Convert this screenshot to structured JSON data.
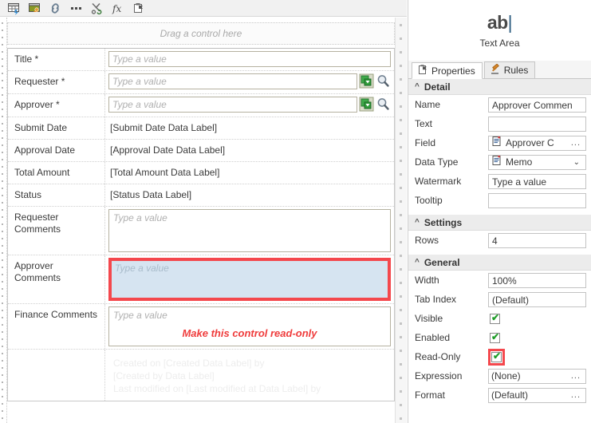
{
  "toolbar": {
    "buttons": [
      {
        "name": "insert-table-icon",
        "title": "Insert table"
      },
      {
        "name": "insert-image-icon",
        "title": "Insert image"
      },
      {
        "name": "insert-link-icon",
        "title": "Insert link"
      },
      {
        "name": "more-options-icon",
        "title": "More"
      },
      {
        "name": "cut-icon",
        "title": "Cut"
      },
      {
        "name": "function-icon",
        "title": "fx"
      },
      {
        "name": "paste-icon",
        "title": "Paste"
      }
    ],
    "fx_label": "fx"
  },
  "canvas": {
    "dropzone_text": "Drag a control here",
    "rows": [
      {
        "label": "Title *",
        "type": "textbox",
        "value": "Type a value"
      },
      {
        "label": "Requester *",
        "type": "people",
        "value": "Type a value"
      },
      {
        "label": "Approver *",
        "type": "people",
        "value": "Type a value"
      },
      {
        "label": "Submit Date",
        "type": "datalabel",
        "value": "[Submit Date Data Label]"
      },
      {
        "label": "Approval Date",
        "type": "datalabel",
        "value": "[Approval Date Data Label]"
      },
      {
        "label": "Total Amount",
        "type": "datalabel",
        "value": "[Total Amount Data Label]"
      },
      {
        "label": "Status",
        "type": "datalabel",
        "value": "[Status Data Label]"
      },
      {
        "label": "Requester Comments",
        "type": "textarea",
        "value": "Type a value"
      },
      {
        "label": "Approver Comments",
        "type": "textarea-selected",
        "value": "Type a value"
      },
      {
        "label": "Finance Comments",
        "type": "textarea-annot",
        "value": "Type a value",
        "annotation": "Make this control read-only"
      }
    ],
    "footer_lines": [
      "Created on  [Created Data Label]  by",
      "[Created by Data Label]",
      "Last modified on  [Last modified at Data Label]  by"
    ]
  },
  "panel": {
    "control_icon_text": "ab",
    "control_icon_caret": "|",
    "control_title": "Text Area",
    "tabs": [
      {
        "label": "Properties",
        "icon": "properties-icon",
        "active": true
      },
      {
        "label": "Rules",
        "icon": "gavel-icon",
        "active": false
      }
    ],
    "sections": [
      {
        "title": "Detail",
        "rows": [
          {
            "label": "Name",
            "kind": "text",
            "value": "Approver Commen"
          },
          {
            "label": "Text",
            "kind": "text",
            "value": ""
          },
          {
            "label": "Field",
            "kind": "picker",
            "value": "Approver C",
            "affordance": "..."
          },
          {
            "label": "Data Type",
            "kind": "dropdown",
            "value": "Memo",
            "affordance": "v"
          },
          {
            "label": "Watermark",
            "kind": "text",
            "value": "Type a value"
          },
          {
            "label": "Tooltip",
            "kind": "text",
            "value": ""
          }
        ]
      },
      {
        "title": "Settings",
        "rows": [
          {
            "label": "Rows",
            "kind": "text",
            "value": "4"
          }
        ]
      },
      {
        "title": "General",
        "rows": [
          {
            "label": "Width",
            "kind": "text",
            "value": "100%"
          },
          {
            "label": "Tab Index",
            "kind": "text",
            "value": "(Default)"
          },
          {
            "label": "Visible",
            "kind": "checkbox",
            "checked": true
          },
          {
            "label": "Enabled",
            "kind": "checkbox",
            "checked": true
          },
          {
            "label": "Read-Only",
            "kind": "checkbox",
            "checked": true,
            "highlighted": true
          },
          {
            "label": "Expression",
            "kind": "picker-plain",
            "value": "(None)",
            "affordance": "..."
          },
          {
            "label": "Format",
            "kind": "picker-plain",
            "value": "(Default)",
            "affordance": "..."
          }
        ]
      }
    ]
  },
  "colors": {
    "selection_red": "#f4484d",
    "selection_fill": "#d6e4f1",
    "annotation_red": "#ef3c3c",
    "checkbox_green": "#1f9d28",
    "panel_section_bg": "#ececec"
  }
}
